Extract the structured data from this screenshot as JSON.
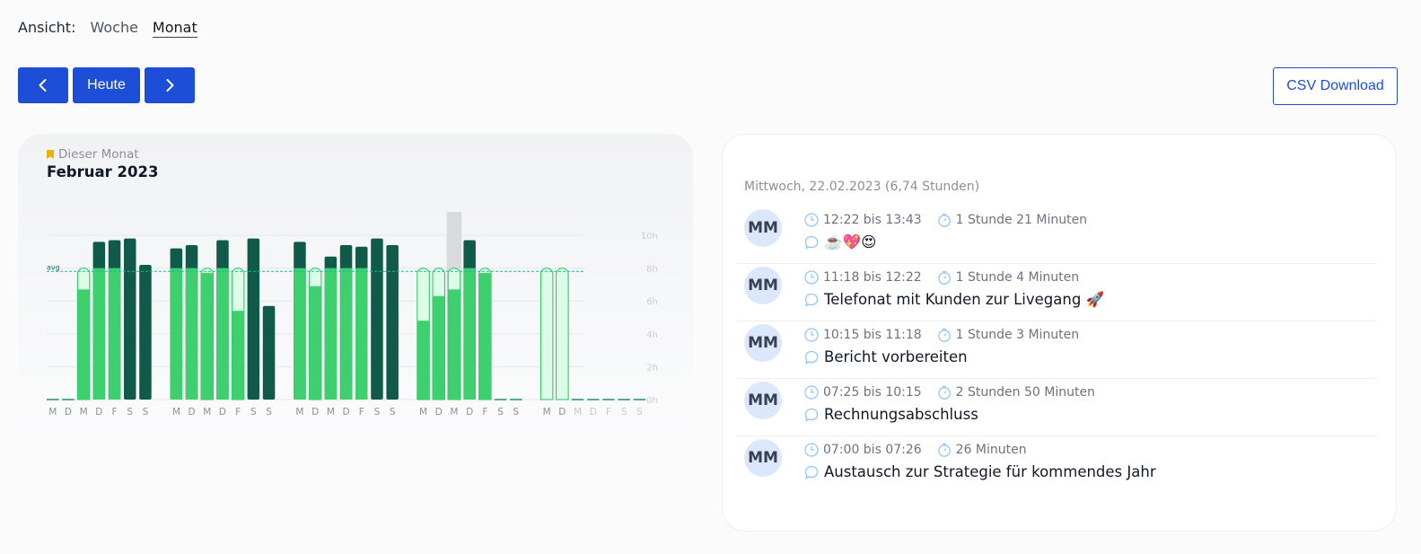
{
  "view": {
    "label": "Ansicht:",
    "options": [
      "Woche",
      "Monat"
    ],
    "active": "Monat"
  },
  "nav": {
    "today_label": "Heute"
  },
  "csv_label": "CSV Download",
  "chart_card": {
    "subtitle": "Dieser Monat",
    "title": "Februar 2023"
  },
  "chart_data": {
    "type": "bar",
    "title": "Februar 2023",
    "avg_label": "avg",
    "avg_value": 7.8,
    "ylim": [
      0,
      10
    ],
    "yticks": [
      "0h",
      "2h",
      "4h",
      "6h",
      "8h",
      "10h"
    ],
    "grid": true,
    "colors": {
      "target": "#dcfce7",
      "target_stroke": "#22c55e",
      "green": "#3ecf6e",
      "dark": "#0f5a48",
      "future_line": "#1f8f6e"
    },
    "days": [
      {
        "label": "M",
        "kind": "empty"
      },
      {
        "label": "D",
        "kind": "empty"
      },
      {
        "label": "M",
        "kind": "green",
        "value": 6.7,
        "target": 8
      },
      {
        "label": "D",
        "kind": "dark",
        "value": 9.6,
        "target": 8
      },
      {
        "label": "F",
        "kind": "dark",
        "value": 9.7,
        "target": 8
      },
      {
        "label": "S",
        "kind": "dark",
        "value": 9.8,
        "target": 0
      },
      {
        "label": "S",
        "kind": "dark",
        "value": 8.2,
        "target": 0
      },
      {
        "label": "gap"
      },
      {
        "label": "M",
        "kind": "dark",
        "value": 9.2,
        "target": 8
      },
      {
        "label": "D",
        "kind": "dark",
        "value": 9.4,
        "target": 8
      },
      {
        "label": "M",
        "kind": "green",
        "value": 7.7,
        "target": 8
      },
      {
        "label": "D",
        "kind": "dark",
        "value": 9.7,
        "target": 8
      },
      {
        "label": "F",
        "kind": "green",
        "value": 5.4,
        "target": 8
      },
      {
        "label": "S",
        "kind": "dark",
        "value": 9.8,
        "target": 0
      },
      {
        "label": "S",
        "kind": "dark",
        "value": 5.7,
        "target": 0
      },
      {
        "label": "gap"
      },
      {
        "label": "M",
        "kind": "dark",
        "value": 9.6,
        "target": 8
      },
      {
        "label": "D",
        "kind": "green",
        "value": 6.9,
        "target": 8
      },
      {
        "label": "M",
        "kind": "dark",
        "value": 8.7,
        "target": 8
      },
      {
        "label": "D",
        "kind": "dark",
        "value": 9.4,
        "target": 8
      },
      {
        "label": "F",
        "kind": "dark",
        "value": 9.3,
        "target": 8
      },
      {
        "label": "S",
        "kind": "dark",
        "value": 9.8,
        "target": 0
      },
      {
        "label": "S",
        "kind": "dark",
        "value": 9.4,
        "target": 0
      },
      {
        "label": "gap"
      },
      {
        "label": "M",
        "kind": "green",
        "value": 4.8,
        "target": 8
      },
      {
        "label": "D",
        "kind": "green",
        "value": 6.3,
        "target": 8
      },
      {
        "label": "M",
        "kind": "green",
        "value": 6.7,
        "target": 8,
        "selected": true
      },
      {
        "label": "D",
        "kind": "dark",
        "value": 9.7,
        "target": 8
      },
      {
        "label": "F",
        "kind": "green",
        "value": 7.7,
        "target": 8
      },
      {
        "label": "S",
        "kind": "empty"
      },
      {
        "label": "S",
        "kind": "empty"
      },
      {
        "label": "gap"
      },
      {
        "label": "M",
        "kind": "target",
        "value": 0,
        "target": 8
      },
      {
        "label": "D",
        "kind": "target",
        "value": 0,
        "target": 8
      },
      {
        "label": "M",
        "kind": "empty",
        "faded": true
      },
      {
        "label": "D",
        "kind": "empty",
        "faded": true
      },
      {
        "label": "F",
        "kind": "empty",
        "faded": true
      },
      {
        "label": "S",
        "kind": "empty",
        "faded": true
      },
      {
        "label": "S",
        "kind": "empty",
        "faded": true
      }
    ]
  },
  "entries_panel": {
    "day_header": "Mittwoch, 22.02.2023 (6,74 Stunden)",
    "entries": [
      {
        "avatar": "MM",
        "time": "12:22 bis 13:43",
        "duration": "1 Stunde 21 Minuten",
        "note": "☕️💖😍"
      },
      {
        "avatar": "MM",
        "time": "11:18 bis 12:22",
        "duration": "1 Stunde 4 Minuten",
        "note": "Telefonat mit Kunden zur Livegang 🚀"
      },
      {
        "avatar": "MM",
        "time": "10:15 bis 11:18",
        "duration": "1 Stunde 3 Minuten",
        "note": "Bericht vorbereiten"
      },
      {
        "avatar": "MM",
        "time": "07:25 bis 10:15",
        "duration": "2 Stunden 50 Minuten",
        "note": "Rechnungsabschluss"
      },
      {
        "avatar": "MM",
        "time": "07:00 bis 07:26",
        "duration": "26 Minuten",
        "note": "Austausch zur Strategie für kommendes Jahr"
      }
    ]
  }
}
